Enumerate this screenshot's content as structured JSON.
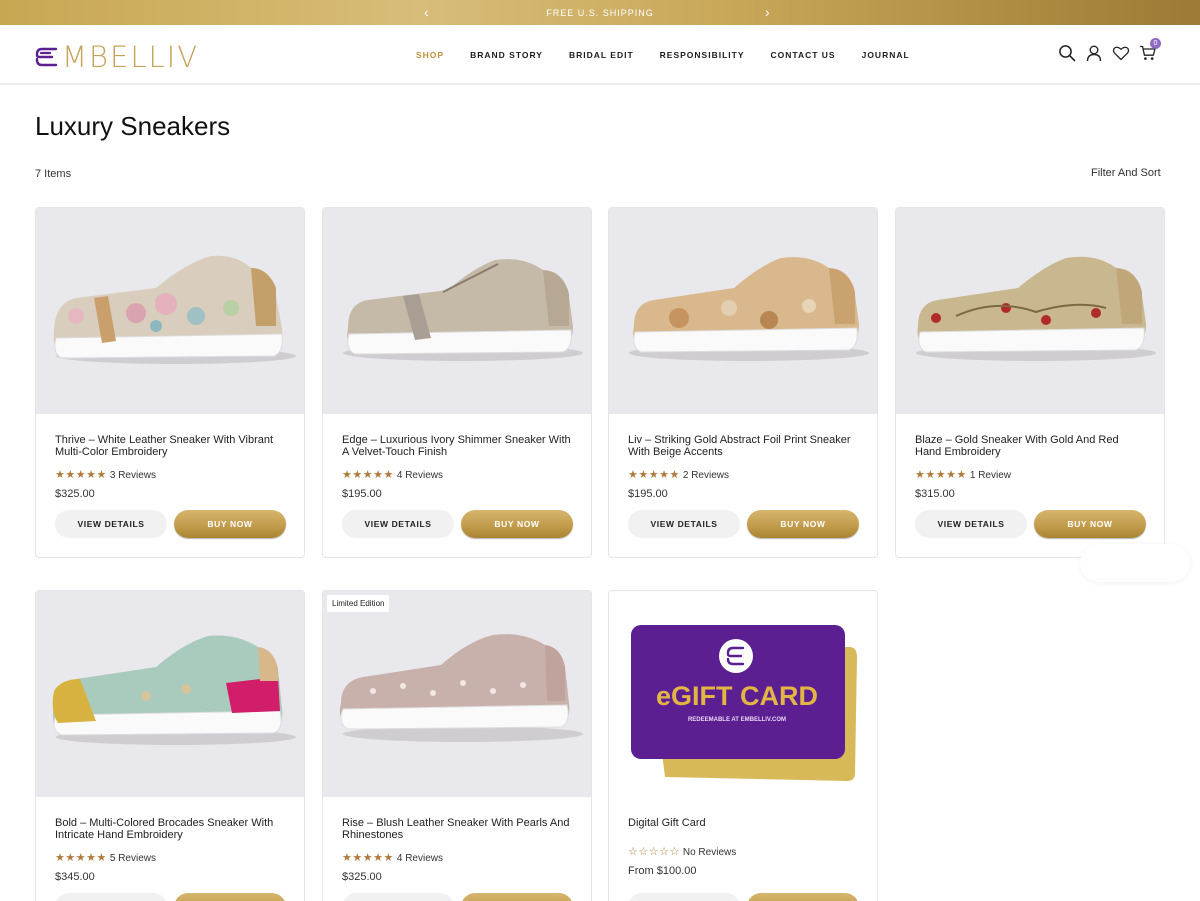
{
  "announcement": {
    "message": "FREE U.S. SHIPPING"
  },
  "brand": {
    "name": "EMBELLIV"
  },
  "nav": {
    "items": [
      {
        "label": "SHOP",
        "active": true
      },
      {
        "label": "BRAND STORY"
      },
      {
        "label": "BRIDAL EDIT"
      },
      {
        "label": "RESPONSIBILITY"
      },
      {
        "label": "CONTACT US"
      },
      {
        "label": "JOURNAL"
      }
    ]
  },
  "header_icons": [
    "search-icon",
    "account-icon",
    "wishlist-heart-icon",
    "cart-icon"
  ],
  "cart": {
    "count": "0"
  },
  "collection": {
    "title": "Luxury Sneakers",
    "count": "7 Items",
    "filter_label": "Filter And Sort"
  },
  "buttons": {
    "view": "VIEW DETAILS",
    "buy": "BUY NOW"
  },
  "products": [
    {
      "name": "Thrive – White Leather Sneaker With Vibrant Multi-Color Embroidery",
      "stars": 5,
      "reviews": "3 Reviews",
      "price": "$325.00"
    },
    {
      "name": "Edge – Luxurious Ivory Shimmer Sneaker With A Velvet-Touch Finish",
      "stars": 5,
      "reviews": "4 Reviews",
      "price": "$195.00"
    },
    {
      "name": "Liv – Striking Gold Abstract Foil Print Sneaker With Beige Accents",
      "stars": 5,
      "reviews": "2 Reviews",
      "price": "$195.00"
    },
    {
      "name": "Blaze – Gold Sneaker With Gold And Red Hand Embroidery",
      "stars": 5,
      "reviews": "1 Review",
      "price": "$315.00"
    },
    {
      "name": "Bold – Multi-Colored Brocades Sneaker With Intricate Hand Embroidery",
      "stars": 5,
      "reviews": "5 Reviews",
      "price": "$345.00"
    },
    {
      "name": "Rise – Blush Leather Sneaker With Pearls And Rhinestones",
      "stars": 5,
      "reviews": "4 Reviews",
      "price": "$325.00",
      "badge": "Limited Edition"
    },
    {
      "name": "Digital Gift Card",
      "stars": 0,
      "reviews": "No Reviews",
      "price": "From $100.00"
    }
  ],
  "gift_card": {
    "title": "eGIFT CARD",
    "subtitle": "REDEEMABLE AT EMBELLIV.COM"
  },
  "colors": {
    "gold": "#c5a45a",
    "purple": "#5b1f91",
    "star": "#b07a3c"
  }
}
